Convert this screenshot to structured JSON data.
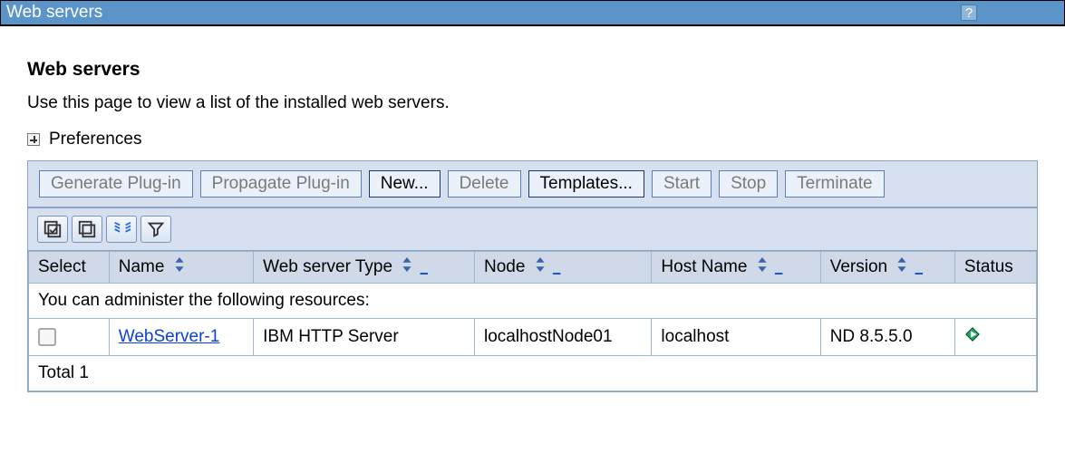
{
  "titlebar": {
    "title": "Web servers"
  },
  "page": {
    "title": "Web servers",
    "description": "Use this page to view a list of the installed web servers.",
    "preferences_label": "Preferences"
  },
  "toolbar": {
    "generate_plugin": "Generate Plug-in",
    "propagate_plugin": "Propagate Plug-in",
    "new": "New...",
    "delete": "Delete",
    "templates": "Templates...",
    "start": "Start",
    "stop": "Stop",
    "terminate": "Terminate"
  },
  "columns": {
    "select": "Select",
    "name": "Name",
    "type": "Web server Type",
    "node": "Node",
    "host": "Host Name",
    "version": "Version",
    "status": "Status"
  },
  "admin_row_text": "You can administer the following resources:",
  "rows": [
    {
      "name": "WebServer-1",
      "type": "IBM HTTP Server",
      "node": "localhostNode01",
      "host": "localhost",
      "version": "ND 8.5.5.0",
      "status": "running"
    }
  ],
  "total_label": "Total 1"
}
